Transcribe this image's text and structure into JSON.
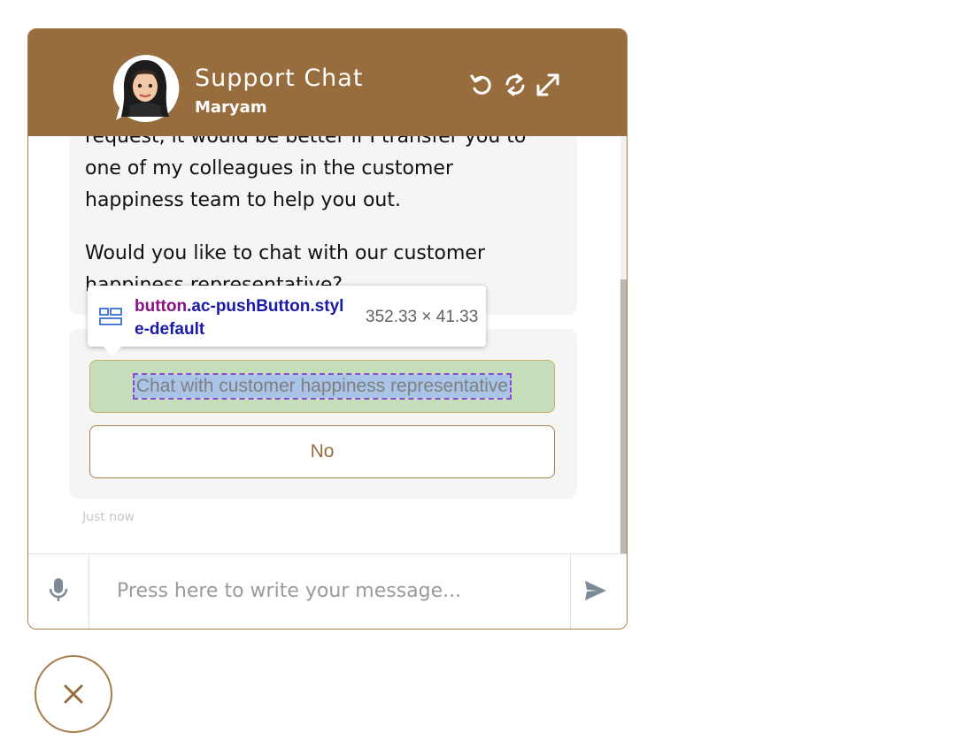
{
  "header": {
    "title": "Support Chat",
    "agent_name": "Maryam",
    "icons": [
      "undo-icon",
      "refresh-icon",
      "expand-icon"
    ]
  },
  "messages": {
    "line1": "request, it would be better if I transfer you to",
    "line2": "one of my colleagues in the customer",
    "line3": "happiness team to help you out.",
    "line4": "Would you like to chat with our customer",
    "line5": "happiness representative?"
  },
  "buttons": {
    "yes_label": "Chat with customer happiness representative",
    "no_label": "No"
  },
  "timestamp": "Just now",
  "input": {
    "placeholder": "Press here to write your message..."
  },
  "devtools_tooltip": {
    "tag": "button",
    "classes_line1": ".ac-pushButton.styl",
    "classes_line2": "e-default",
    "size": "352.33 × 41.33"
  },
  "colors": {
    "brand": "#986d3d",
    "highlight_green": "#c3deb8",
    "highlight_blue": "#a9c4e6"
  }
}
